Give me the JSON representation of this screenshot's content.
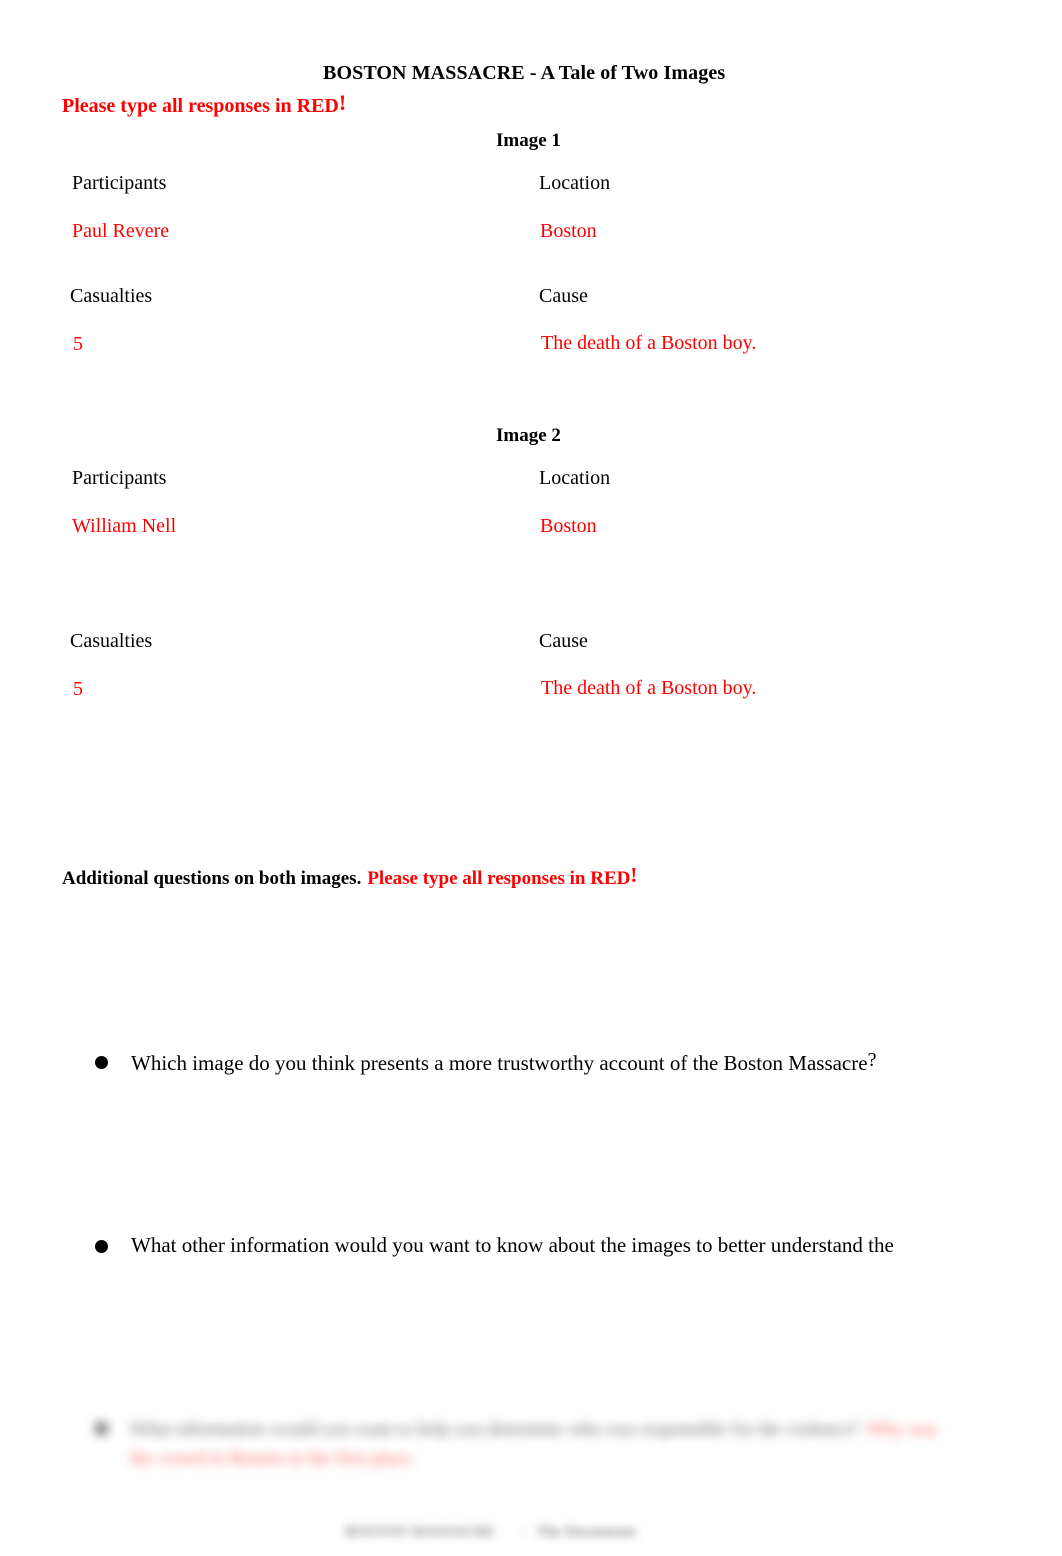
{
  "document": {
    "title": "BOSTON MASSACRE - A Tale of Two Images",
    "instruction": "Please type all responses in RED",
    "instruction_bang": "!"
  },
  "colors": {
    "response_red": "#FF0000",
    "body_black": "#000000",
    "page_background": "#FFFFFF"
  },
  "sections": [
    {
      "heading": "Image 1",
      "fields": {
        "participants_label": "Participants",
        "participants_value": "Paul Revere",
        "location_label": "Location",
        "location_value": "Boston",
        "casualties_label": "Casualties",
        "casualties_value": "5",
        "cause_label": "Cause",
        "cause_value": "The death of a Boston boy."
      }
    },
    {
      "heading": "Image 2",
      "fields": {
        "participants_label": "Participants",
        "participants_value": "William Nell",
        "location_label": "Location",
        "location_value": "Boston",
        "casualties_label": "Casualties",
        "casualties_value": "5",
        "cause_label": "Cause",
        "cause_value": "The death of a Boston boy."
      }
    }
  ],
  "additional": {
    "lead_black": "Additional questions on both images.",
    "lead_red": "Please type all responses in RED",
    "lead_bang": "!",
    "questions": [
      {
        "text": "Which image do you think presents a more trustworthy account of the Boston Massacre",
        "qmark": "?"
      },
      {
        "text": "What other information would you want to know about the images to better understand the"
      }
    ],
    "blurred_question": {
      "text": "What information would you want to help you determine who was responsible for the violence?",
      "response": "Why was the crowd in Boston in the first place."
    }
  },
  "footer": {
    "left": "BOSTON MASSACRE",
    "dash": "-",
    "right": "The Documents"
  }
}
